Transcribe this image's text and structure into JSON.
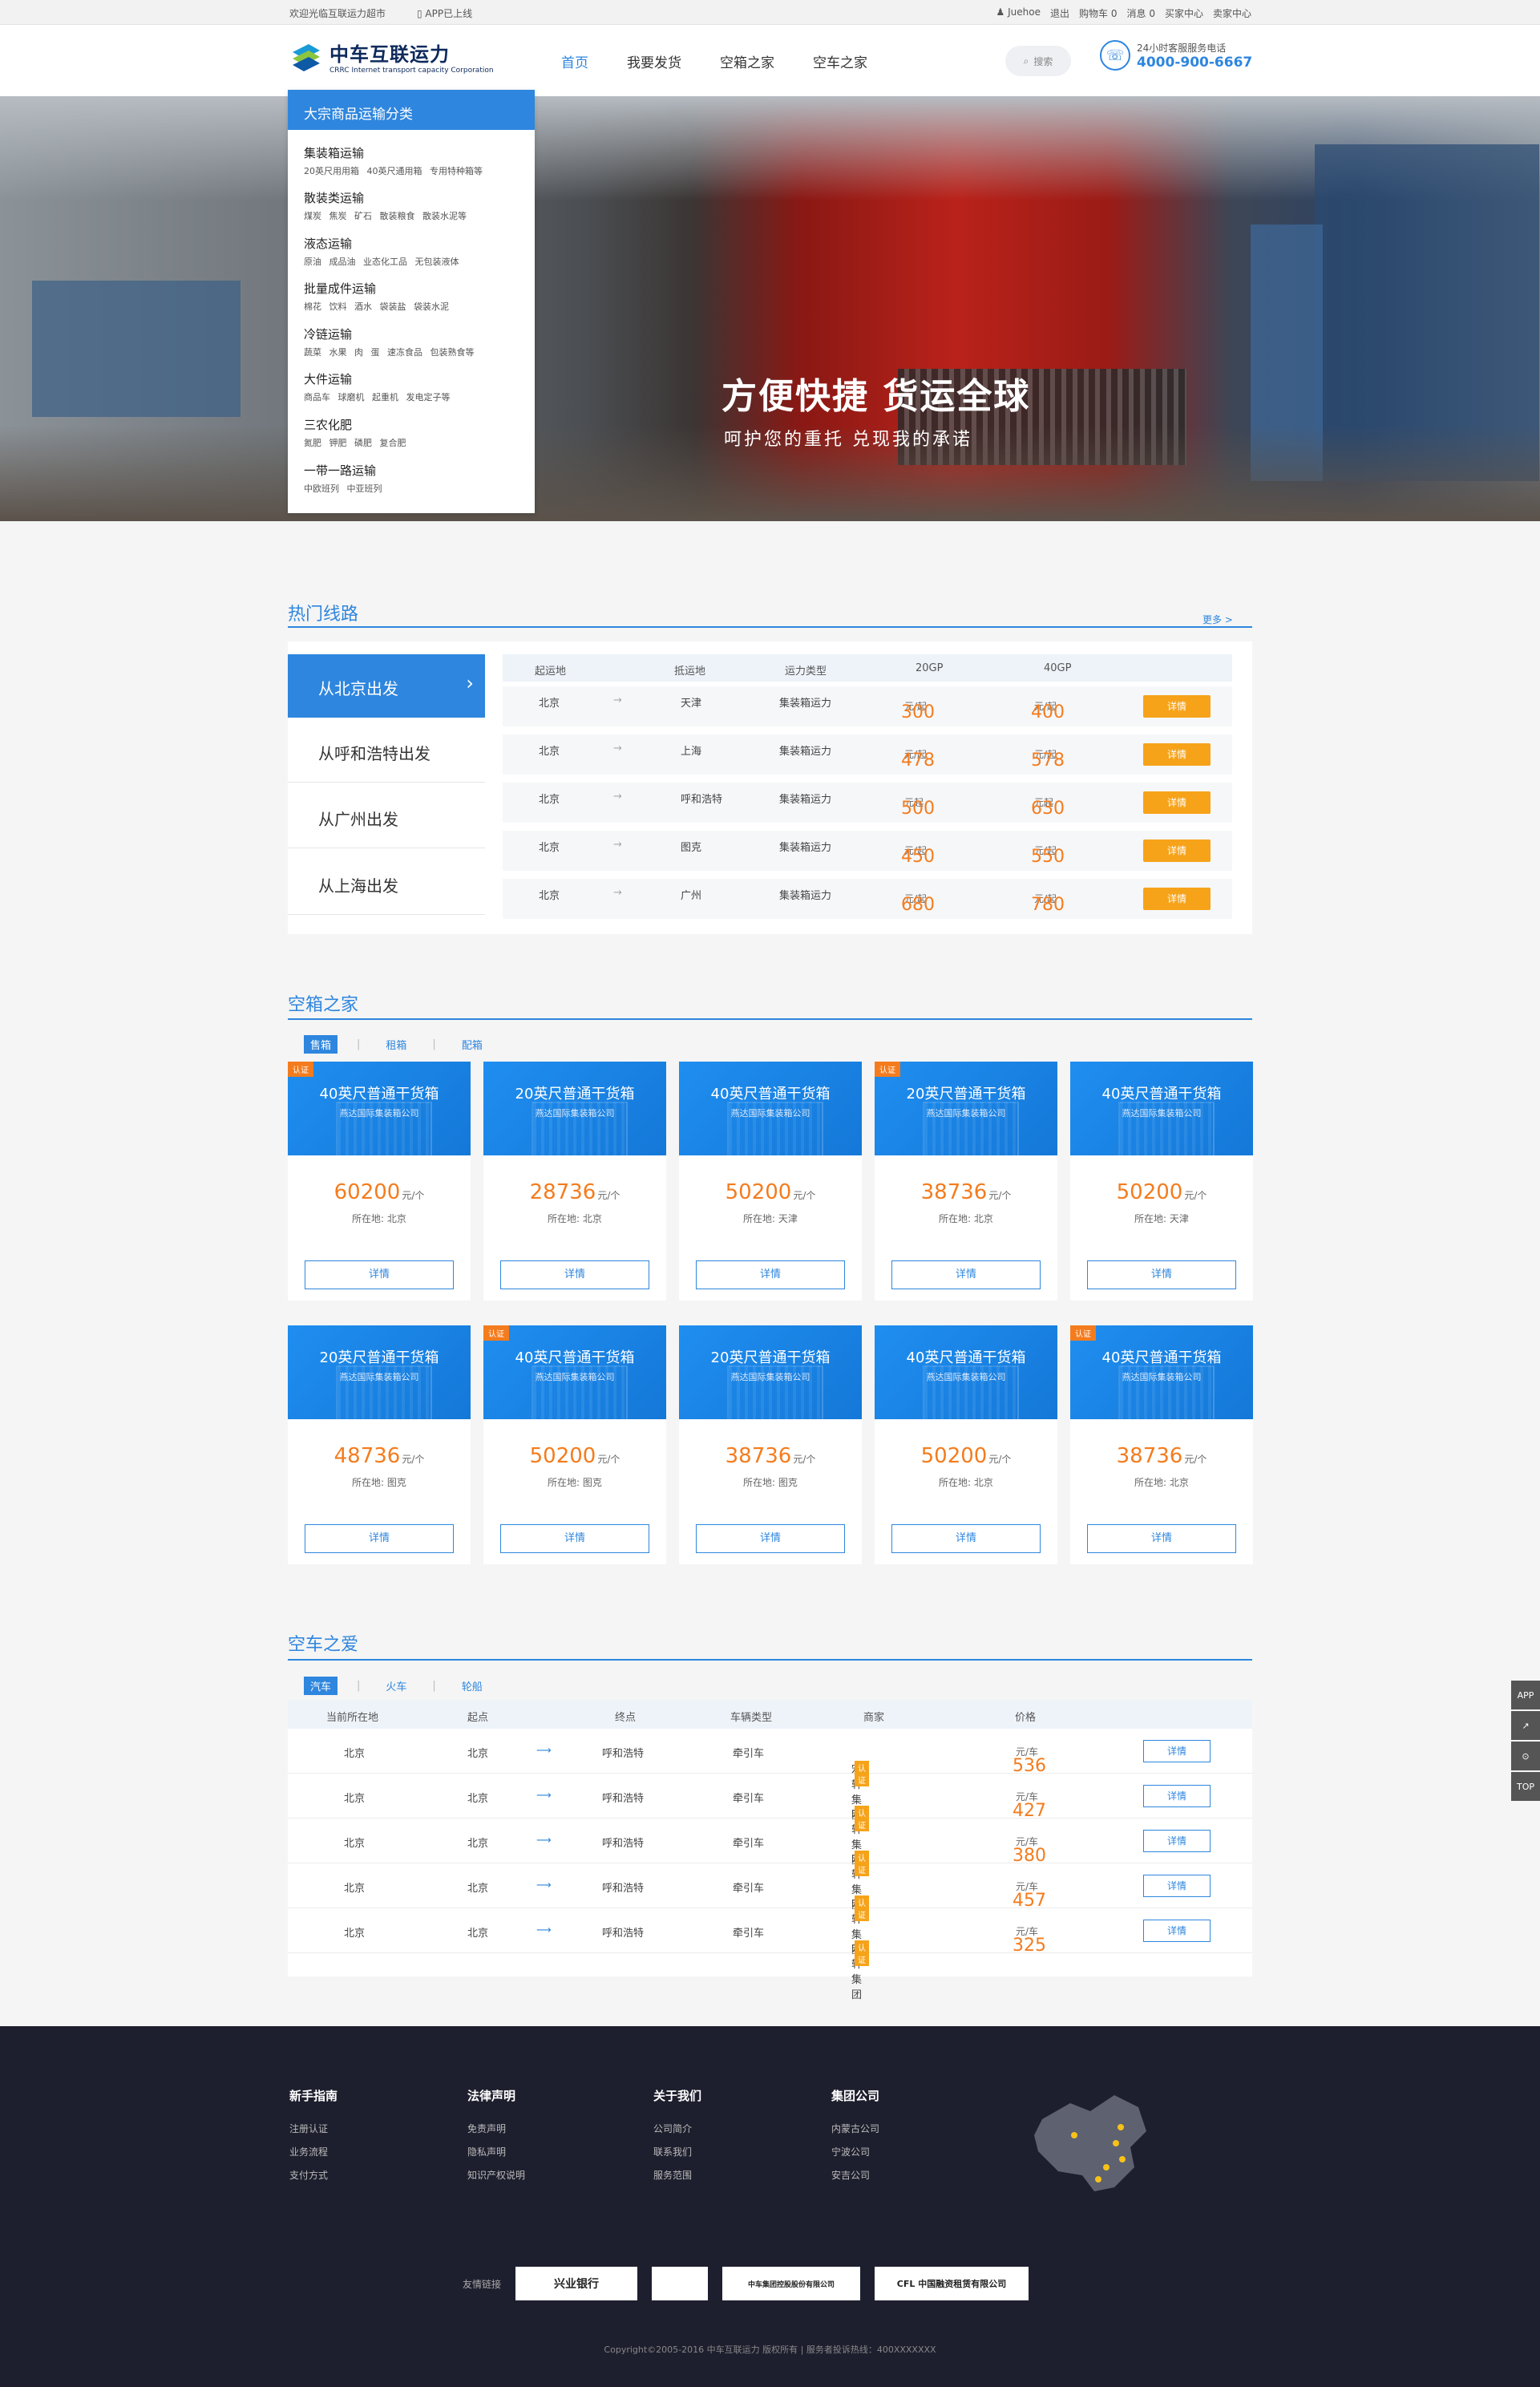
{
  "topbar": {
    "welcome": "欢迎光临互联运力超市",
    "app": "APP已上线",
    "user": "Juehoe",
    "logout": "退出",
    "cart": "购物车",
    "cart_count": "0",
    "msg": "消息",
    "msg_count": "0",
    "buyer": "买家中心",
    "seller": "卖家中心"
  },
  "logo": {
    "name": "中车互联运力",
    "en": "CRRC Internet transport capacity Corporation"
  },
  "nav": [
    "首页",
    "我要发货",
    "空箱之家",
    "空车之家"
  ],
  "search": {
    "label": "搜索"
  },
  "hotline": {
    "label": "24小时客服服务电话",
    "phone": "4000-900-6667"
  },
  "hero": {
    "slogan1": "方便快捷  货运全球",
    "slogan2": "呵护您的重托  兑现我的承诺"
  },
  "categories": {
    "title": "大宗商品运输分类",
    "items": [
      {
        "name": "集装箱运输",
        "sub": "20英尺用用箱 40英尺通用箱 专用特种箱等"
      },
      {
        "name": "散装类运输",
        "sub": "煤炭 焦炭 矿石 散装粮食 散装水泥等"
      },
      {
        "name": "液态运输",
        "sub": "原油 成品油 业态化工品 无包装液体"
      },
      {
        "name": "批量成件运输",
        "sub": "棉花 饮料 酒水 袋装盐 袋装水泥"
      },
      {
        "name": "冷链运输",
        "sub": "蔬菜 水果 肉 蛋 速冻食品 包装熟食等"
      },
      {
        "name": "大件运输",
        "sub": "商品车 球磨机 起重机 发电定子等"
      },
      {
        "name": "三农化肥",
        "sub": "氮肥 钾肥 磷肥 复合肥"
      },
      {
        "name": "一带一路运输",
        "sub": "中欧班列 中亚班列"
      }
    ]
  },
  "hot": {
    "title": "热门线路",
    "more": "更多 >",
    "tabs": [
      "从北京出发",
      "从呼和浩特出发",
      "从广州出发",
      "从上海出发"
    ],
    "headers": [
      "起运地",
      "抵运地",
      "运力类型",
      "20GP",
      "40GP"
    ],
    "rows": [
      {
        "from": "北京",
        "to": "天津",
        "type": "集装箱运力",
        "p20": "300",
        "u20": "元/起",
        "p40": "400",
        "u40": "元/起",
        "btn": "详情"
      },
      {
        "from": "北京",
        "to": "上海",
        "type": "集装箱运力",
        "p20": "478",
        "u20": "元/起",
        "p40": "578",
        "u40": "元/起",
        "btn": "详情"
      },
      {
        "from": "北京",
        "to": "呼和浩特",
        "type": "集装箱运力",
        "p20": "500",
        "u20": "元起",
        "p40": "630",
        "u40": "元起",
        "btn": "详情"
      },
      {
        "from": "北京",
        "to": "图克",
        "type": "集装箱运力",
        "p20": "450",
        "u20": "元/起",
        "p40": "550",
        "u40": "元/起",
        "btn": "详情"
      },
      {
        "from": "北京",
        "to": "广州",
        "type": "集装箱运力",
        "p20": "680",
        "u20": "元/起",
        "p40": "780",
        "u40": "元/起",
        "btn": "详情"
      }
    ]
  },
  "box": {
    "title": "空箱之家",
    "tabs": [
      "售箱",
      "租箱",
      "配箱"
    ],
    "cards": [
      {
        "name": "40英尺普通干货箱",
        "co": "燕达国际集装箱公司",
        "badge": "认证",
        "price": "60200",
        "unit": "元/个",
        "loc_label": "所在地:",
        "loc": "北京",
        "btn": "详情"
      },
      {
        "name": "20英尺普通干货箱",
        "co": "燕达国际集装箱公司",
        "badge": "",
        "price": "28736",
        "unit": "元/个",
        "loc_label": "所在地:",
        "loc": "北京",
        "btn": "详情"
      },
      {
        "name": "40英尺普通干货箱",
        "co": "燕达国际集装箱公司",
        "badge": "",
        "price": "50200",
        "unit": "元/个",
        "loc_label": "所在地:",
        "loc": "天津",
        "btn": "详情"
      },
      {
        "name": "20英尺普通干货箱",
        "co": "燕达国际集装箱公司",
        "badge": "认证",
        "price": "38736",
        "unit": "元/个",
        "loc_label": "所在地:",
        "loc": "北京",
        "btn": "详情"
      },
      {
        "name": "40英尺普通干货箱",
        "co": "燕达国际集装箱公司",
        "badge": "",
        "price": "50200",
        "unit": "元/个",
        "loc_label": "所在地:",
        "loc": "天津",
        "btn": "详情"
      },
      {
        "name": "20英尺普通干货箱",
        "co": "燕达国际集装箱公司",
        "badge": "",
        "price": "48736",
        "unit": "元/个",
        "loc_label": "所在地:",
        "loc": "图克",
        "btn": "详情"
      },
      {
        "name": "40英尺普通干货箱",
        "co": "燕达国际集装箱公司",
        "badge": "认证",
        "price": "50200",
        "unit": "元/个",
        "loc_label": "所在地:",
        "loc": "图克",
        "btn": "详情"
      },
      {
        "name": "20英尺普通干货箱",
        "co": "燕达国际集装箱公司",
        "badge": "",
        "price": "38736",
        "unit": "元/个",
        "loc_label": "所在地:",
        "loc": "图克",
        "btn": "详情"
      },
      {
        "name": "40英尺普通干货箱",
        "co": "燕达国际集装箱公司",
        "badge": "",
        "price": "50200",
        "unit": "元/个",
        "loc_label": "所在地:",
        "loc": "北京",
        "btn": "详情"
      },
      {
        "name": "40英尺普通干货箱",
        "co": "燕达国际集装箱公司",
        "badge": "认证",
        "price": "38736",
        "unit": "元/个",
        "loc_label": "所在地:",
        "loc": "北京",
        "btn": "详情"
      }
    ]
  },
  "truck": {
    "title": "空车之爱",
    "tabs": [
      "汽车",
      "火车",
      "轮船"
    ],
    "headers": [
      "当前所在地",
      "起点",
      "终点",
      "车辆类型",
      "商家",
      "价格"
    ],
    "rows": [
      {
        "cur": "北京",
        "from": "北京",
        "to": "呼和浩特",
        "type": "牵引车",
        "merchant": "宏轩集团",
        "badge": "认证",
        "price": "536",
        "unit": "元/车",
        "btn": "详情"
      },
      {
        "cur": "北京",
        "from": "北京",
        "to": "呼和浩特",
        "type": "牵引车",
        "merchant": "宏轩集团",
        "badge": "认证",
        "price": "427",
        "unit": "元/车",
        "btn": "详情"
      },
      {
        "cur": "北京",
        "from": "北京",
        "to": "呼和浩特",
        "type": "牵引车",
        "merchant": "宏轩集团",
        "badge": "认证",
        "price": "380",
        "unit": "元/车",
        "btn": "详情"
      },
      {
        "cur": "北京",
        "from": "北京",
        "to": "呼和浩特",
        "type": "牵引车",
        "merchant": "宏轩集团",
        "badge": "认证",
        "price": "457",
        "unit": "元/车",
        "btn": "详情"
      },
      {
        "cur": "北京",
        "from": "北京",
        "to": "呼和浩特",
        "type": "牵引车",
        "merchant": "宏轩集团",
        "badge": "认证",
        "price": "325",
        "unit": "元/车",
        "btn": "详情"
      }
    ]
  },
  "footer": {
    "cols": [
      {
        "h": "新手指南",
        "items": [
          "注册认证",
          "业务流程",
          "支付方式"
        ]
      },
      {
        "h": "法律声明",
        "items": [
          "免责声明",
          "隐私声明",
          "知识产权说明"
        ]
      },
      {
        "h": "关于我们",
        "items": [
          "公司简介",
          "联系我们",
          "服务范围"
        ]
      },
      {
        "h": "集团公司",
        "items": [
          "内蒙古公司",
          "宁波公司",
          "安吉公司"
        ]
      }
    ],
    "links_label": "友情链接",
    "links": [
      "兴业银行",
      "",
      "中车集团控股股份有限公司",
      "CFL 中国融资租赁有限公司"
    ],
    "copyright": "Copyright©2005-2016  中车互联运力 版权所有 | 服务者投诉热线：400XXXXXXX"
  },
  "sidebar": [
    "APP",
    "↗",
    "⊙",
    "TOP"
  ]
}
